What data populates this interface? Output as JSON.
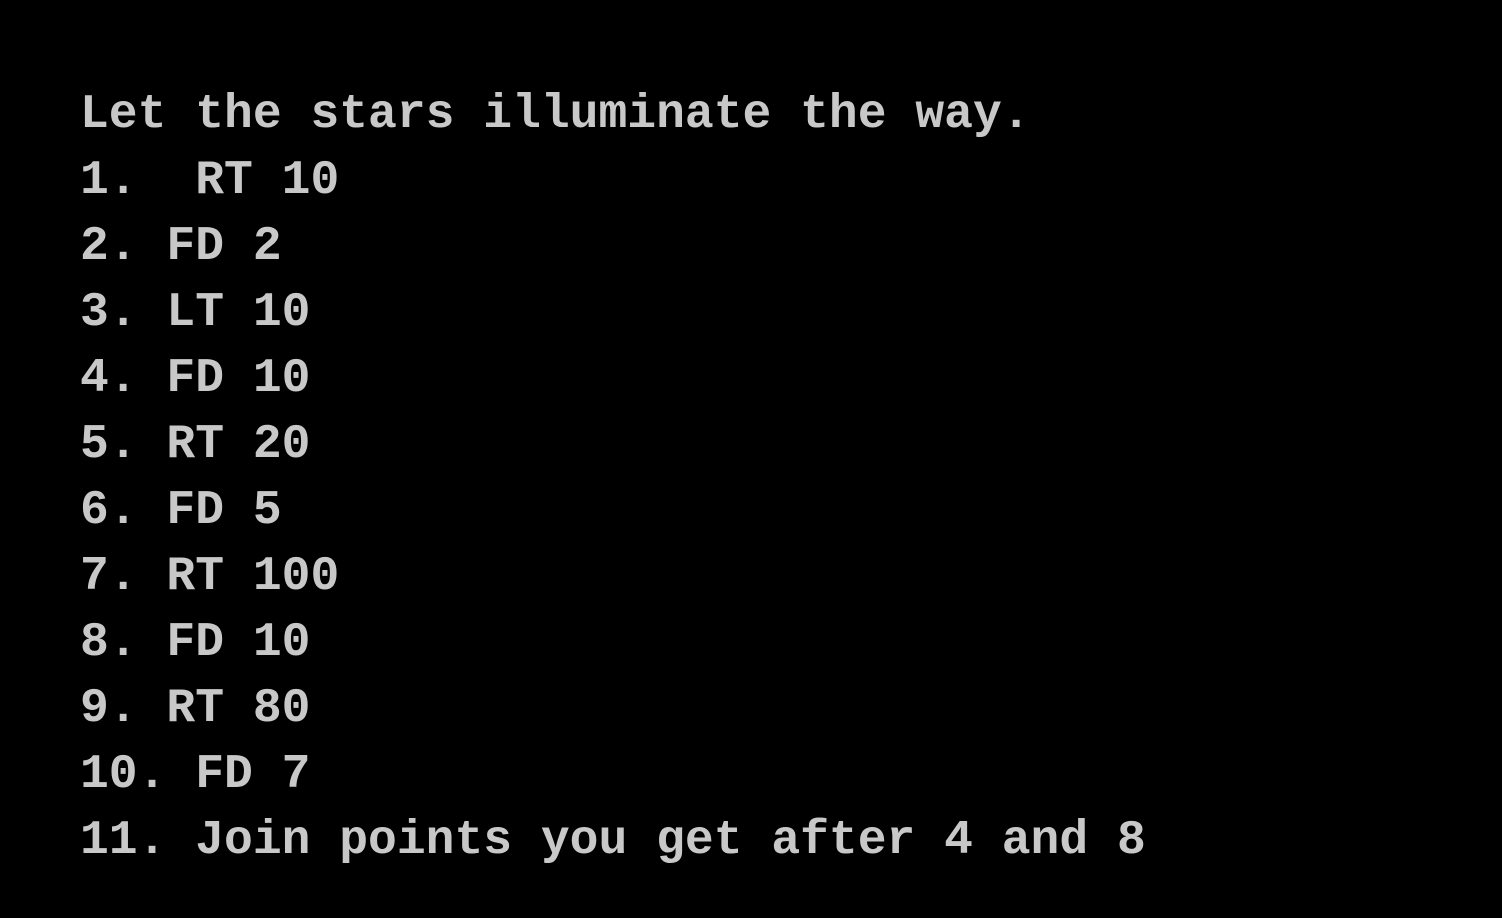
{
  "document": {
    "background_color": "#000000",
    "text_color": "#c8c8c8",
    "heading": "Let the stars illuminate the way.",
    "steps": [
      "1.  RT 10",
      "2. FD 2",
      "3. LT 10",
      "4. FD 10",
      "5. RT 20",
      "6. FD 5",
      "7. RT 100",
      "8. FD 10",
      "9. RT 80",
      "10. FD 7",
      "11. Join points you get after 4 and 8"
    ]
  }
}
